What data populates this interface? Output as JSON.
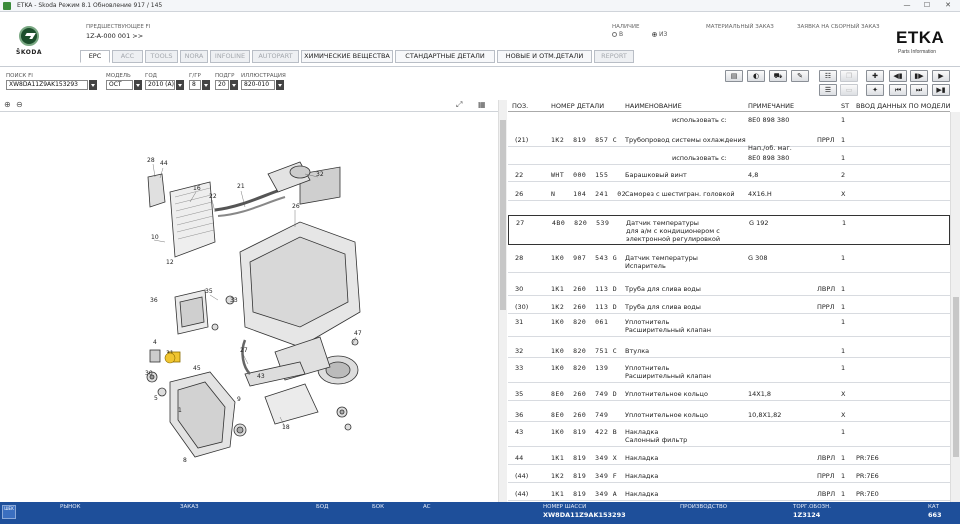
{
  "window": {
    "title": "ETKA - Skoda Режим 8.1 Обновление 917 / 145",
    "minimize": "—",
    "maximize": "☐",
    "close": "✕"
  },
  "header": {
    "brand_word": "ŠKODA",
    "predecessor_label": "ПРЕДШЕСТВУЮЩЕЕ FI",
    "predecessor_value": "1Z-A-000 001 >>",
    "availability_label": "НАЛИЧИЕ",
    "option_v": "В",
    "option_iz": "ИЗ",
    "material_order": "МАТЕРИАЛЬНЫЙ ЗАКАЗ",
    "assembly_request": "ЗАЯВКА НА СБОРНЫЙ ЗАКАЗ",
    "etka_logo": "ETKA",
    "etka_sub": "Parts Information"
  },
  "tabs": [
    {
      "label": "EPC",
      "state": "active"
    },
    {
      "label": "ACC",
      "state": "disabled"
    },
    {
      "label": "TOOLS",
      "state": "disabled"
    },
    {
      "label": "NORA",
      "state": "disabled"
    },
    {
      "label": "INFOLINE",
      "state": "disabled"
    },
    {
      "label": "AUTOPART",
      "state": "disabled"
    },
    {
      "label": "ХИМИЧЕСКИЕ ВЕЩЕСТВА",
      "state": "enabled"
    },
    {
      "label": "СТАНДАРТНЫЕ ДЕТАЛИ",
      "state": "enabled"
    },
    {
      "label": "НОВЫЕ И ОТМ.ДЕТАЛИ",
      "state": "enabled"
    },
    {
      "label": "REPORT",
      "state": "disabled"
    }
  ],
  "toolbar": {
    "search_label": "ПОИСК FI",
    "search_value": "XW8DA11Z9AK153293",
    "model_label": "МОДЕЛЬ",
    "model_value": "OCT",
    "year_label": "ГОД",
    "year_value": "2010 (A)",
    "hg_label": "Г/ГР",
    "hg_value": "8",
    "sg_label": "ПОДГР",
    "sg_value": "20",
    "illustration_label": "ИЛЛЮСТРАЦИЯ",
    "illustration_value": "820-010",
    "icon_buttons": [
      "print-icon",
      "cart-icon",
      "car-icon",
      "tool-icon",
      "list-icon",
      "copy-icon",
      "note-icon",
      "doc-icon",
      "pin-icon",
      "prev-page-icon",
      "next-page-icon",
      "info-icon",
      "first-icon",
      "last-icon"
    ]
  },
  "illus_toolbar": {
    "zoom_in": "⊕",
    "zoom_out": "⊖",
    "fit": "⤢",
    "print": "▦"
  },
  "table": {
    "headers": {
      "pos": "ПОЗ.",
      "part_no": "НОМЕР ДЕТАЛИ",
      "name": "НАИМЕНОВАНИЕ",
      "note": "ПРИМЕЧАНИЕ",
      "st": "ST",
      "model_data": "ВВОД ДАННЫХ ПО МОДЕЛИ"
    },
    "rows": [
      {
        "pos": "",
        "part": "",
        "name": "использовать с:",
        "note": "8E0 898 380",
        "code": "",
        "st": "1",
        "model": "",
        "lines": 1,
        "indent": true
      },
      {
        "pos": "(21)",
        "part": "1K2  819  857 C",
        "name": "Трубопровод системы охлаждения",
        "note": "",
        "code": "ПРРЛ",
        "st": "1",
        "model": "",
        "lines": 1
      },
      {
        "pos": "",
        "part": "",
        "name": "",
        "note": "Нап./об. маг.",
        "code": "",
        "st": "",
        "model": "",
        "lines": 1
      },
      {
        "pos": "",
        "part": "",
        "name": "использовать с:",
        "note": "8E0 898 380",
        "code": "",
        "st": "1",
        "model": "",
        "lines": 1,
        "indent": true
      },
      {
        "pos": "22",
        "part": "WHT  000  155",
        "name": "Барашковый винт",
        "note": "4,8",
        "code": "",
        "st": "2",
        "model": "",
        "lines": 1
      },
      {
        "pos": "26",
        "part": "N    104  241  02",
        "name": "Саморез с шестигран. головкой",
        "note": "4X16.H",
        "code": "",
        "st": "X",
        "model": "",
        "lines": 1
      },
      {
        "pos": "27",
        "part": "4B0  820  539",
        "name": "Датчик температуры\nдля а/м с кондиционером с\nэлектронной регулировкой",
        "note": "G 192",
        "code": "",
        "st": "1",
        "model": "",
        "lines": 3,
        "selected": true
      },
      {
        "pos": "28",
        "part": "1K0  907  543 G",
        "name": "Датчик температуры\nИспаритель",
        "note": "G 308",
        "code": "",
        "st": "1",
        "model": "",
        "lines": 2
      },
      {
        "pos": "30",
        "part": "1K1  260  113 D",
        "name": "Труба для слива воды",
        "note": "",
        "code": "ЛВРЛ",
        "st": "1",
        "model": "",
        "lines": 1
      },
      {
        "pos": "(30)",
        "part": "1K2  260  113 D",
        "name": "Труба для слива воды",
        "note": "",
        "code": "ПРРЛ",
        "st": "1",
        "model": "",
        "lines": 1
      },
      {
        "pos": "31",
        "part": "1K0  820  061",
        "name": "Уплотнитель\nРасширительный клапан",
        "note": "",
        "code": "",
        "st": "1",
        "model": "",
        "lines": 2
      },
      {
        "pos": "32",
        "part": "1K0  820  751 C",
        "name": "Втулка",
        "note": "",
        "code": "",
        "st": "1",
        "model": "",
        "lines": 1
      },
      {
        "pos": "33",
        "part": "1K0  820  139",
        "name": "Уплотнитель\nРасширительный клапан",
        "note": "",
        "code": "",
        "st": "1",
        "model": "",
        "lines": 2
      },
      {
        "pos": "35",
        "part": "8E0  260  749 D",
        "name": "Уплотнительное кольцо",
        "note": "14X1,8",
        "code": "",
        "st": "X",
        "model": "",
        "lines": 1
      },
      {
        "pos": "36",
        "part": "8E0  260  749",
        "name": "Уплотнительное кольцо",
        "note": "10,8X1,82",
        "code": "",
        "st": "X",
        "model": "",
        "lines": 1
      },
      {
        "pos": "43",
        "part": "1K0  819  422 B",
        "name": "Накладка\nСалонный фильтр",
        "note": "",
        "code": "",
        "st": "1",
        "model": "",
        "lines": 2
      },
      {
        "pos": "44",
        "part": "1K1  819  349 X",
        "name": "Накладка",
        "note": "",
        "code": "ЛВРЛ",
        "st": "1",
        "model": "PR:7E6",
        "lines": 1
      },
      {
        "pos": "(44)",
        "part": "1K2  819  349 F",
        "name": "Накладка",
        "note": "",
        "code": "ПРРЛ",
        "st": "1",
        "model": "PR:7E6",
        "lines": 1
      },
      {
        "pos": "(44)",
        "part": "1K1  819  349 A",
        "name": "Накладка",
        "note": "",
        "code": "ЛВРЛ",
        "st": "1",
        "model": "PR:7E0",
        "lines": 1
      }
    ]
  },
  "diagram": {
    "callouts": [
      "28",
      "44",
      "16",
      "21",
      "22",
      "32",
      "26",
      "10",
      "35",
      "31",
      "27",
      "47",
      "33",
      "36",
      "18",
      "30",
      "4",
      "45",
      "1",
      "43",
      "12",
      "8",
      "5",
      "9"
    ]
  },
  "statusbar": {
    "icon_text": "ШEK",
    "market": "РЫНОК",
    "order": "ЗАКАЗ",
    "bod": "БОД",
    "bok": "БОК",
    "ac": "AC",
    "chassis_label": "НОМЕР ШАССИ",
    "chassis_value": "XW8DA11Z9AK153293",
    "production": "ПРОИЗВОДСТВО",
    "trade_label": "ТОРГ.ОБОЗН.",
    "trade_value": "1Z3124",
    "cat_label": "КАТ",
    "cat_value": "663"
  }
}
